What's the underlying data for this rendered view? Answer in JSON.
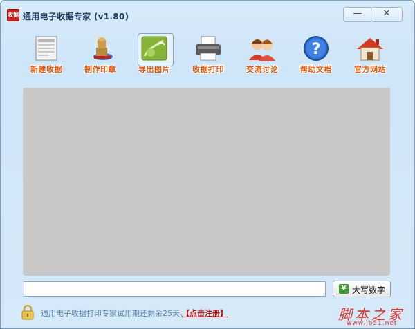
{
  "window": {
    "title": "通用电子收据专家 (v1.80)",
    "app_icon_text": "收据",
    "minimize_symbol": "—",
    "close_symbol": "✕"
  },
  "toolbar": {
    "items": [
      {
        "label": "新建收据",
        "icon": "new-receipt-icon"
      },
      {
        "label": "制作印章",
        "icon": "make-seal-icon"
      },
      {
        "label": "导出图片",
        "icon": "export-image-icon"
      },
      {
        "label": "收据打印",
        "icon": "print-receipt-icon"
      },
      {
        "label": "交流讨论",
        "icon": "discussion-icon"
      },
      {
        "label": "帮助文档",
        "icon": "help-icon"
      },
      {
        "label": "官方网站",
        "icon": "home-icon"
      }
    ],
    "selected_index": 2
  },
  "converter": {
    "input_value": "",
    "button_label": "大写数字",
    "button_icon_text": "¥"
  },
  "status": {
    "message": "通用电子收据打印专家试用期还剩余25天、",
    "register_label": "【点击注册】"
  },
  "watermark": {
    "main": "脚本之家",
    "sub": "www.jb51.net"
  },
  "colors": {
    "window_bg": "#d7eaf9",
    "label_orange": "#e35a10",
    "canvas_gray": "#c8c8c8",
    "register_red": "#b0140d",
    "status_blue": "#5b7fa6"
  }
}
